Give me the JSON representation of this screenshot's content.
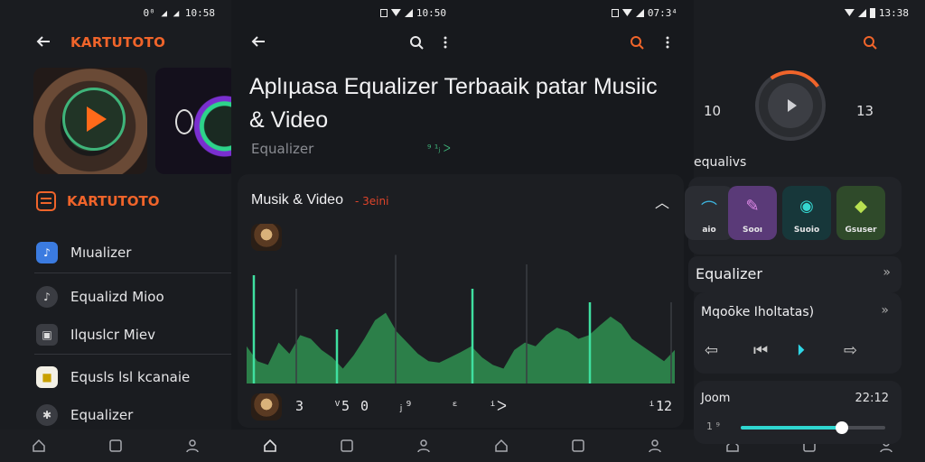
{
  "panel1": {
    "status": "0⁰ ◢ ◢ 10:58",
    "brand": "KARTUTOTO",
    "section_title": "KARTUTOTO",
    "items": [
      {
        "label": "Mıualizer",
        "icon": "equalizer-icon"
      },
      {
        "label": "Equalizd Mioo",
        "icon": "music-note-icon"
      },
      {
        "label": "Ilquslcr Miev",
        "icon": "media-icon"
      },
      {
        "label": "Equsls lsl kcanaie",
        "icon": "star-icon"
      },
      {
        "label": "Equalizer",
        "icon": "settings-icon"
      }
    ]
  },
  "panel2": {
    "status": "10:50",
    "title": "Aplıµasa Equalizer Terbaaik patar Musiic & Video",
    "sub_label": "Equalizer",
    "sub_code": "⁹ ¹ⱼ ᐳ",
    "card": {
      "title": "Musik & Video",
      "tag": "- 3eini",
      "controls": [
        "3",
        "ⱽ5",
        "0",
        "ⱼ⁹",
        "ᵋ",
        "ⁱᐳ"
      ],
      "end_value": "ⁱ12"
    },
    "eq_bars": [
      0.5,
      0.3,
      0.25,
      0.55,
      0.4,
      0.65,
      0.6,
      0.45,
      0.35,
      0.2,
      0.38,
      0.6,
      0.85,
      0.95,
      0.7,
      0.55,
      0.4,
      0.3,
      0.28,
      0.35,
      0.42,
      0.5,
      0.35,
      0.25,
      0.2,
      0.45,
      0.55,
      0.5,
      0.65,
      0.75,
      0.7,
      0.6,
      0.65,
      0.78,
      0.9,
      0.8,
      0.6,
      0.5,
      0.4,
      0.3,
      0.45
    ]
  },
  "panel3": {
    "status": "07:3⁴"
  },
  "panel4": {
    "status": "13:38",
    "dial_left": "10",
    "dial_right": "13",
    "section_label": "equalivs",
    "apps": [
      {
        "label": "aio",
        "color": "#2b2d33",
        "glyph_color": "#3db5e0"
      },
      {
        "label": "Sooı",
        "color": "#5a3a78",
        "glyph_color": "#e08ae8"
      },
      {
        "label": "Suoio",
        "color": "#17373a",
        "glyph_color": "#35d6d0"
      },
      {
        "label": "Gsuser",
        "color": "#2f4a2a",
        "glyph_color": "#b8e050"
      }
    ],
    "row_equalizer": "Equalizer",
    "player_title": "Mqoōke Iholtatas)",
    "volume_label": "Joom",
    "volume_value": "22:12",
    "volume_lead": "1 ⁹",
    "volume_level": 0.7
  },
  "nav_icons": [
    "home-icon",
    "square-icon",
    "profile-icon"
  ]
}
